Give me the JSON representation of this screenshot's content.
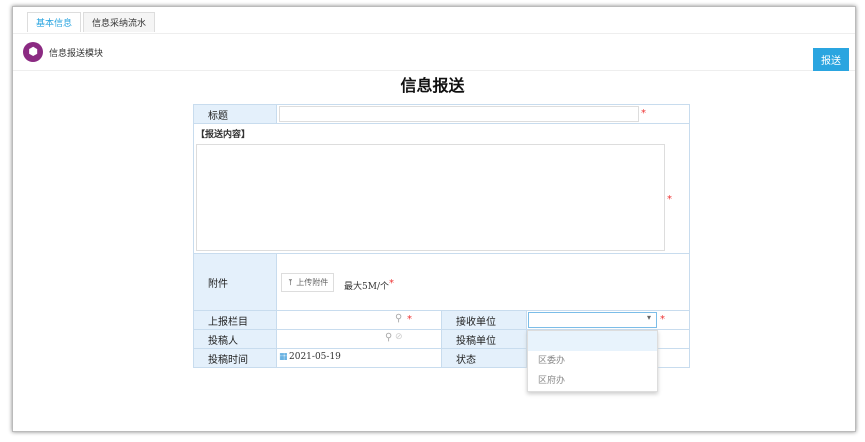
{
  "tabs": [
    {
      "label": "基本信息",
      "active": true
    },
    {
      "label": "信息采纳流水",
      "active": false
    }
  ],
  "header": {
    "module_title": "信息报送模块",
    "send_button": "报送"
  },
  "form": {
    "title": "信息报送",
    "fields": {
      "title_label": "标题",
      "content_label": "【报送内容】",
      "attachment_label": "附件",
      "upload_button": "上传附件",
      "upload_hint": "最大5M/个",
      "column_label": "上报栏目",
      "receiver_label": "接收单位",
      "author_label": "投稿人",
      "author_unit_label": "投稿单位",
      "date_label": "投稿时间",
      "date_value": "2021-05-19",
      "status_label": "状态"
    },
    "required_mark": "*",
    "receiver_options": [
      "",
      "区委办",
      "区府办"
    ]
  },
  "colors": {
    "accent": "#2aa5e0",
    "label_bg": "#e4f0fb",
    "logo": "#8b2a82"
  }
}
